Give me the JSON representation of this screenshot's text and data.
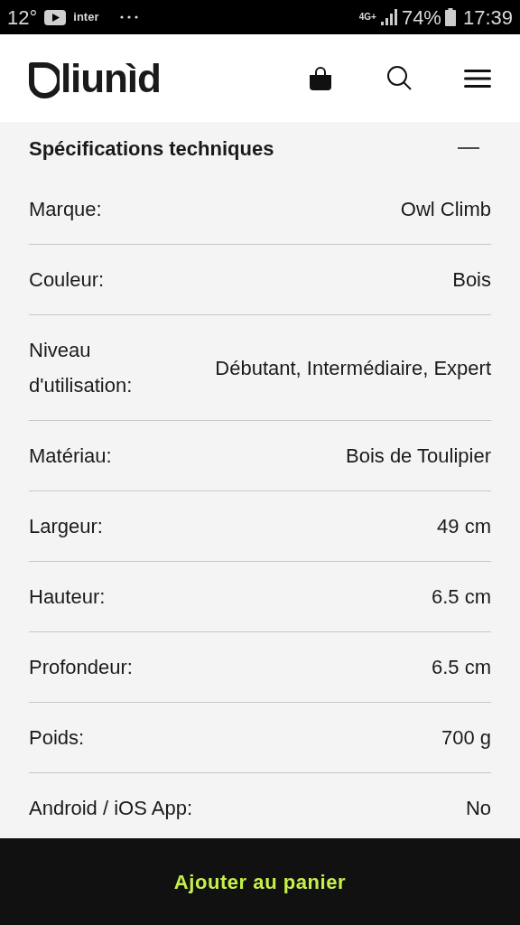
{
  "status_bar": {
    "temperature": "12°",
    "app_label": "inter",
    "network": "4G+",
    "battery": "74%",
    "time": "17:39"
  },
  "header": {
    "logo_text": "liunìd"
  },
  "section": {
    "title": "Spécifications techniques",
    "expanded": true
  },
  "specs": [
    {
      "label": "Marque:",
      "value": "Owl Climb"
    },
    {
      "label": "Couleur:",
      "value": "Bois"
    },
    {
      "label": "Niveau d'utilisation:",
      "value": "Débutant, Intermédiaire, Expert"
    },
    {
      "label": "Matériau:",
      "value": "Bois de Toulipier"
    },
    {
      "label": "Largeur:",
      "value": "49 cm"
    },
    {
      "label": "Hauteur:",
      "value": "6.5 cm"
    },
    {
      "label": "Profondeur:",
      "value": "6.5 cm"
    },
    {
      "label": "Poids:",
      "value": "700 g"
    },
    {
      "label": "Android / iOS App:",
      "value": "No"
    }
  ],
  "cart_button": "Ajouter au panier"
}
